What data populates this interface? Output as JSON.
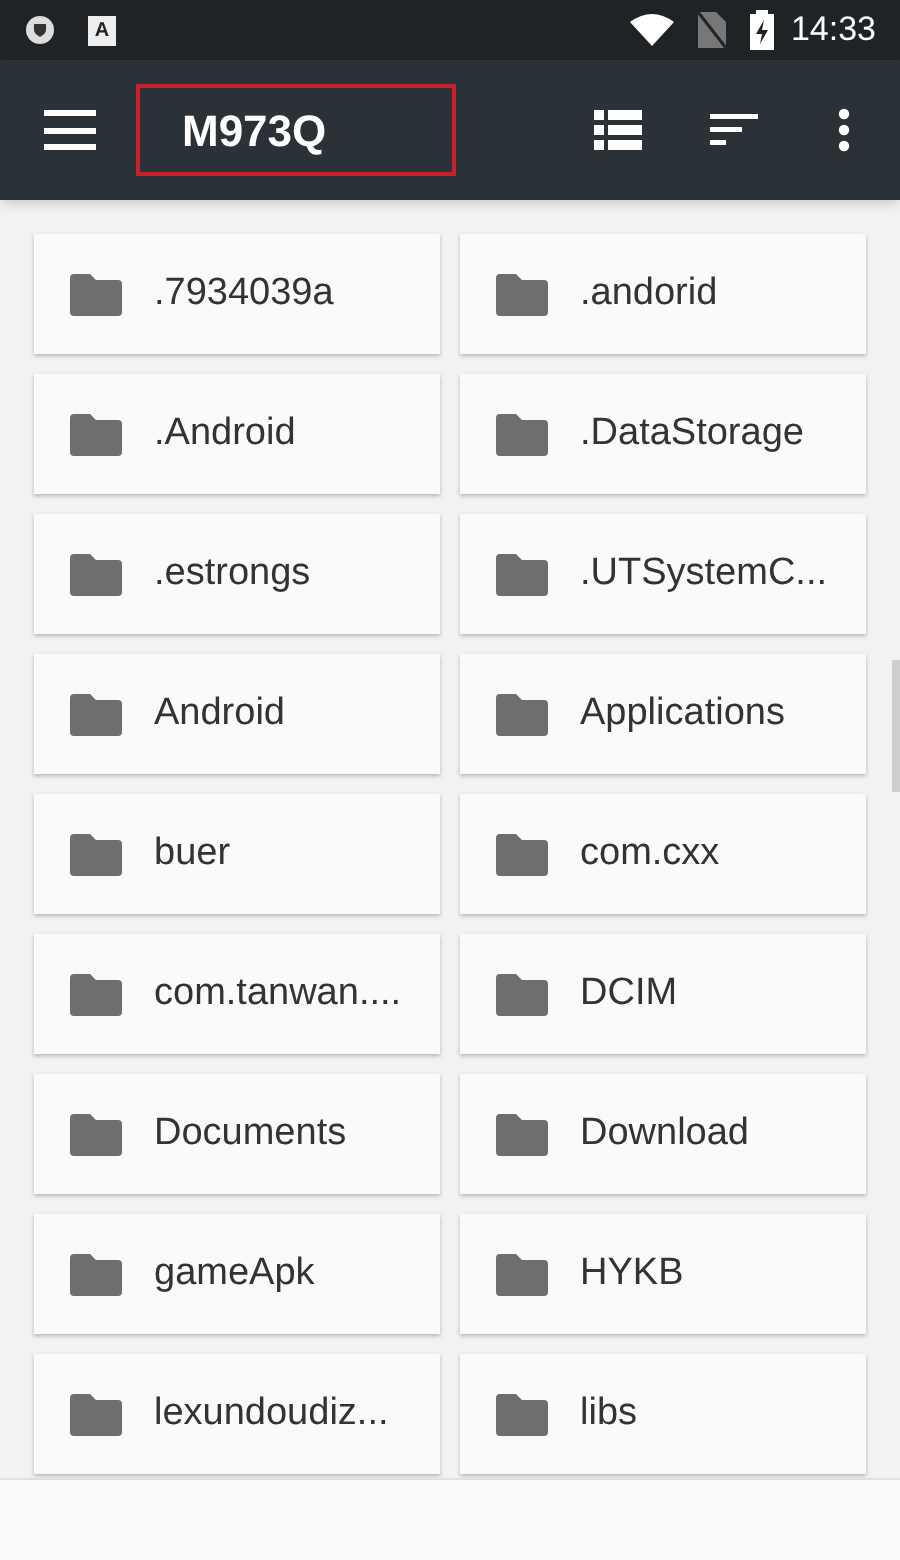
{
  "status_bar": {
    "time": "14:33",
    "notification_letter": "A"
  },
  "toolbar": {
    "title": "M973Q",
    "title_highlighted": true
  },
  "folders": [
    {
      "name": ".7934039a"
    },
    {
      "name": ".andorid"
    },
    {
      "name": ".Android"
    },
    {
      "name": ".DataStorage"
    },
    {
      "name": ".estrongs"
    },
    {
      "name": ".UTSystemC..."
    },
    {
      "name": "Android"
    },
    {
      "name": "Applications"
    },
    {
      "name": "buer"
    },
    {
      "name": "com.cxx"
    },
    {
      "name": "com.tanwan...."
    },
    {
      "name": "DCIM"
    },
    {
      "name": "Documents"
    },
    {
      "name": "Download"
    },
    {
      "name": "gameApk"
    },
    {
      "name": "HYKB"
    },
    {
      "name": "lexundoudiz..."
    },
    {
      "name": "libs"
    }
  ]
}
